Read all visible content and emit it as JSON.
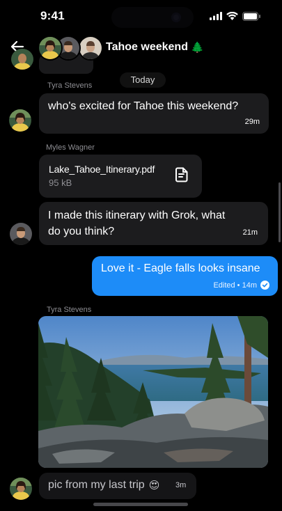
{
  "status": {
    "time": "9:41"
  },
  "header": {
    "title": "Tahoe weekend",
    "title_emoji": "🌲"
  },
  "chat": {
    "date_divider": "Today",
    "messages": [
      {
        "sender": "Tyra Stevens",
        "text": "who's excited for Tahoe this weekend?",
        "timestamp": "29m"
      },
      {
        "sender": "Myles Wagner",
        "file_name": "Lake_Tahoe_Itinerary.pdf",
        "file_size": "95 kB"
      },
      {
        "text": "I made this itinerary with Grok, what do you think?",
        "timestamp": "21m"
      },
      {
        "text": "Love it - Eagle falls looks insane",
        "status": "Edited • 14m"
      },
      {
        "sender": "Tyra Stevens",
        "image_subject": "Emerald Bay, Lake Tahoe viewed from a rocky trail with pine trees"
      },
      {
        "text": "pic from my last trip",
        "emoji": "😍",
        "timestamp": "3m"
      }
    ]
  },
  "colors": {
    "accent": "#1d8cf8",
    "bubble": "#1c1c1e",
    "background": "#000000",
    "muted": "#8e8e93"
  },
  "icons": [
    "back-arrow-icon",
    "signal-icon",
    "wifi-icon",
    "battery-icon",
    "pine-tree-emoji",
    "document-icon",
    "checkmark-circle-icon"
  ]
}
